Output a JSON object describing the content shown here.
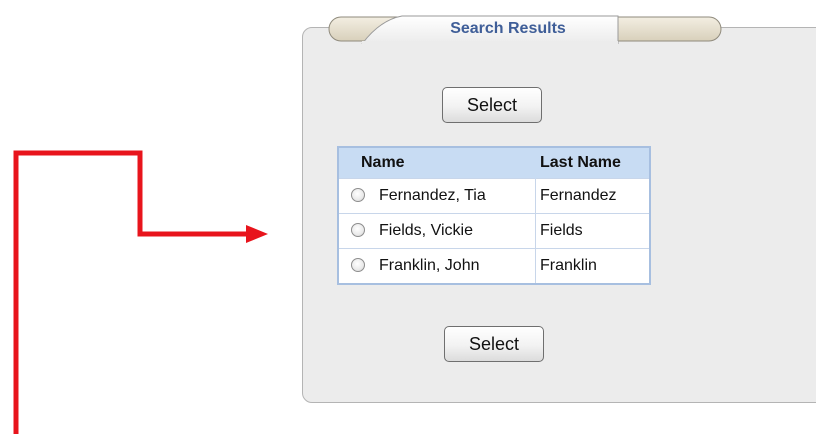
{
  "panel": {
    "title": "Search Results"
  },
  "buttons": {
    "select_top": "Select",
    "select_bottom": "Select"
  },
  "table": {
    "headers": {
      "name": "Name",
      "last_name": "Last Name"
    },
    "rows": [
      {
        "name": "Fernandez, Tia",
        "last_name": "Fernandez",
        "selected": false
      },
      {
        "name": "Fields, Vickie",
        "last_name": "Fields",
        "selected": false
      },
      {
        "name": "Franklin, John",
        "last_name": "Franklin",
        "selected": false
      }
    ]
  },
  "colors": {
    "annotation_arrow": "#e8141c",
    "title_text": "#3f5e98",
    "header_bg": "#c8dcf3",
    "table_border": "#a7bfe0",
    "panel_bg": "#ececec"
  },
  "icons": {
    "annotation": "red-elbow-arrow-icon",
    "row_selector": "radio-button-icon"
  }
}
